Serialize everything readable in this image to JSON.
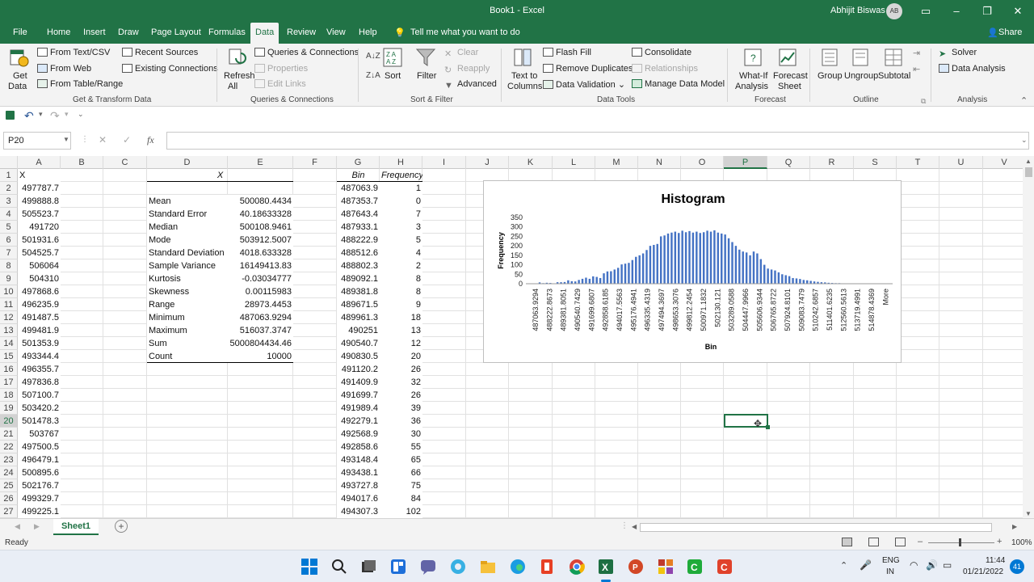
{
  "window": {
    "title": "Book1  -  Excel",
    "user": "Abhijit Biswas",
    "initials": "AB"
  },
  "tabs": [
    "File",
    "Home",
    "Insert",
    "Draw",
    "Page Layout",
    "Formulas",
    "Data",
    "Review",
    "View",
    "Help"
  ],
  "tell_me": "Tell me what you want to do",
  "share": "Share",
  "ribbon": {
    "get_data": "Get",
    "get_data2": "Data",
    "from_text": "From Text/CSV",
    "from_web": "From Web",
    "from_table": "From Table/Range",
    "recent": "Recent Sources",
    "existing": "Existing Connections",
    "grp_get": "Get & Transform Data",
    "refresh": "Refresh",
    "refresh2": "All",
    "queries": "Queries & Connections",
    "properties": "Properties",
    "edit_links": "Edit Links",
    "grp_queries": "Queries & Connections",
    "sort": "Sort",
    "filter": "Filter",
    "clear": "Clear",
    "reapply": "Reapply",
    "advanced": "Advanced",
    "grp_sort": "Sort & Filter",
    "text_to_col": "Text to",
    "text_to_col2": "Columns",
    "flash_fill": "Flash Fill",
    "remove_dup": "Remove Duplicates",
    "data_validation": "Data Validation",
    "consolidate": "Consolidate",
    "relationships": "Relationships",
    "manage_model": "Manage Data Model",
    "grp_tools": "Data Tools",
    "whatif": "What-If",
    "whatif2": "Analysis",
    "forecast": "Forecast",
    "forecast2": "Sheet",
    "grp_forecast": "Forecast",
    "group": "Group",
    "ungroup": "Ungroup",
    "subtotal": "Subtotal",
    "grp_outline": "Outline",
    "solver": "Solver",
    "data_analysis": "Data Analysis",
    "grp_analysis": "Analysis"
  },
  "namebox": "P20",
  "columns": [
    "A",
    "B",
    "C",
    "D",
    "E",
    "F",
    "G",
    "H",
    "I",
    "J",
    "K",
    "L",
    "M",
    "N",
    "O",
    "P",
    "Q",
    "R",
    "S",
    "T",
    "U",
    "V"
  ],
  "rows": [
    "1",
    "2",
    "3",
    "4",
    "5",
    "6",
    "7",
    "8",
    "9",
    "10",
    "11",
    "12",
    "13",
    "14",
    "15",
    "16",
    "17",
    "18",
    "19",
    "20",
    "21",
    "22",
    "23",
    "24",
    "25",
    "26",
    "27"
  ],
  "col_a": [
    "X",
    "497787.7",
    "499888.8",
    "505523.7",
    "491720",
    "501931.6",
    "504525.7",
    "506064",
    "504310",
    "497868.6",
    "496235.9",
    "491487.5",
    "499481.9",
    "501353.9",
    "493344.4",
    "496355.7",
    "497836.8",
    "507100.7",
    "503420.2",
    "501478.3",
    "503767",
    "497500.5",
    "496479.1",
    "500895.6",
    "502176.7",
    "499329.7",
    "499225.1"
  ],
  "stats": {
    "header": "X",
    "labels": [
      "Mean",
      "Standard Error",
      "Median",
      "Mode",
      "Standard Deviation",
      "Sample Variance",
      "Kurtosis",
      "Skewness",
      "Range",
      "Minimum",
      "Maximum",
      "Sum",
      "Count"
    ],
    "values": [
      "500080.4434",
      "40.18633328",
      "500108.9461",
      "503912.5007",
      "4018.633328",
      "16149413.83",
      "-0.03034777",
      "0.00115983",
      "28973.4453",
      "487063.9294",
      "516037.3747",
      "5000804434.46",
      "10000"
    ]
  },
  "bins": {
    "bin_header": "Bin",
    "freq_header": "Frequency",
    "bin": [
      "487063.9",
      "487353.7",
      "487643.4",
      "487933.1",
      "488222.9",
      "488512.6",
      "488802.3",
      "489092.1",
      "489381.8",
      "489671.5",
      "489961.3",
      "490251",
      "490540.7",
      "490830.5",
      "491120.2",
      "491409.9",
      "491699.7",
      "491989.4",
      "492279.1",
      "492568.9",
      "492858.6",
      "493148.4",
      "493438.1",
      "493727.8",
      "494017.6",
      "494307.3"
    ],
    "freq": [
      "1",
      "0",
      "7",
      "3",
      "5",
      "4",
      "2",
      "8",
      "8",
      "9",
      "18",
      "13",
      "12",
      "20",
      "26",
      "32",
      "26",
      "39",
      "36",
      "30",
      "55",
      "65",
      "66",
      "75",
      "84",
      "102"
    ]
  },
  "chart_data": {
    "type": "bar",
    "title": "Histogram",
    "xlabel": "Bin",
    "ylabel": "Frequency",
    "ylim": [
      0,
      350
    ],
    "yticks": [
      "0",
      "50",
      "100",
      "150",
      "200",
      "250",
      "300",
      "350"
    ],
    "tick_labels": [
      "487063.9294",
      "488222.8673",
      "489381.8051",
      "490540.7429",
      "491699.6807",
      "492858.6185",
      "494017.5563",
      "495176.4941",
      "496335.4319",
      "497494.3697",
      "498653.3076",
      "499812.2454",
      "500971.1832",
      "502130.121",
      "503289.0588",
      "504447.9966",
      "505606.9344",
      "506765.8722",
      "507924.8101",
      "509083.7479",
      "510242.6857",
      "511401.6235",
      "512560.5613",
      "513719.4991",
      "514878.4369",
      "More"
    ],
    "values": [
      1,
      0,
      7,
      3,
      5,
      4,
      2,
      8,
      8,
      9,
      18,
      13,
      12,
      20,
      26,
      32,
      26,
      39,
      36,
      30,
      55,
      65,
      66,
      75,
      84,
      102,
      106,
      110,
      125,
      142,
      150,
      160,
      178,
      200,
      205,
      210,
      250,
      255,
      265,
      270,
      275,
      268,
      280,
      272,
      278,
      270,
      275,
      268,
      272,
      280,
      275,
      282,
      270,
      265,
      260,
      240,
      220,
      200,
      180,
      170,
      165,
      150,
      170,
      160,
      130,
      100,
      80,
      75,
      70,
      60,
      50,
      45,
      40,
      30,
      28,
      25,
      20,
      18,
      15,
      12,
      10,
      8,
      7,
      5,
      4,
      3,
      3,
      2,
      1,
      1,
      2,
      1,
      0,
      1,
      0,
      0,
      1,
      0,
      0,
      0,
      0
    ]
  },
  "sheet_tab": "Sheet1",
  "status": "Ready",
  "zoom": "100%",
  "tray": {
    "lang1": "ENG",
    "lang2": "IN",
    "time": "11:44",
    "date": "01/21/2022",
    "badge": "41"
  }
}
